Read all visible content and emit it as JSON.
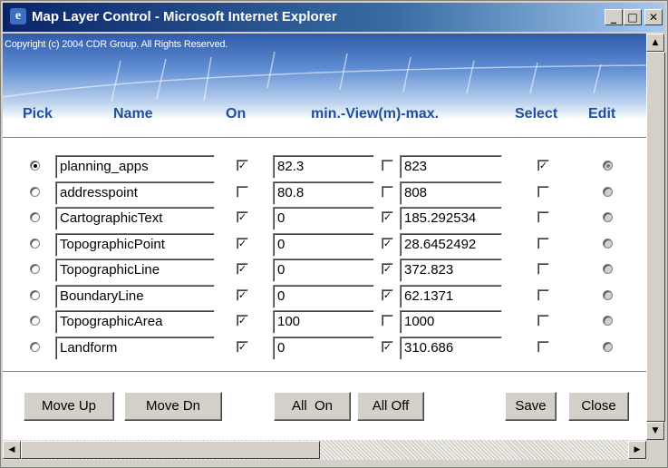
{
  "window": {
    "title": "Map Layer Control - Microsoft Internet Explorer",
    "min_glyph": "_",
    "max_glyph": "□",
    "close_glyph": "✕"
  },
  "banner": {
    "copyright": "Copyright (c) 2004 CDR Group. All Rights Reserved."
  },
  "headers": {
    "pick": "Pick",
    "name": "Name",
    "on": "On",
    "view": "min.-View(m)-max.",
    "select": "Select",
    "edit": "Edit"
  },
  "layers": [
    {
      "pick": true,
      "name": "planning_apps",
      "on": true,
      "min": "82.3",
      "max_on": false,
      "max": "823",
      "select": true,
      "edit": true
    },
    {
      "pick": false,
      "name": "addresspoint",
      "on": false,
      "min": "80.8",
      "max_on": false,
      "max": "808",
      "select": false,
      "edit": false
    },
    {
      "pick": false,
      "name": "CartographicText",
      "on": true,
      "min": "0",
      "max_on": true,
      "max": "185.292534",
      "select": false,
      "edit": false
    },
    {
      "pick": false,
      "name": "TopographicPoint",
      "on": true,
      "min": "0",
      "max_on": true,
      "max": "28.6452492",
      "select": false,
      "edit": false
    },
    {
      "pick": false,
      "name": "TopographicLine",
      "on": true,
      "min": "0",
      "max_on": true,
      "max": "372.823",
      "select": false,
      "edit": false
    },
    {
      "pick": false,
      "name": "BoundaryLine",
      "on": true,
      "min": "0",
      "max_on": true,
      "max": "62.1371",
      "select": false,
      "edit": false
    },
    {
      "pick": false,
      "name": "TopographicArea",
      "on": true,
      "min": "100",
      "max_on": false,
      "max": "1000",
      "select": false,
      "edit": false
    },
    {
      "pick": false,
      "name": "Landform",
      "on": true,
      "min": "0",
      "max_on": true,
      "max": "310.686",
      "select": false,
      "edit": false
    }
  ],
  "buttons": {
    "move_up": "Move Up",
    "move_dn": "Move Dn",
    "all_on": "All  On",
    "all_off": "All Off",
    "save": "Save",
    "close": "Close"
  },
  "scrollbar": {
    "up": "▲",
    "down": "▼",
    "left": "◀",
    "right": "▶"
  }
}
